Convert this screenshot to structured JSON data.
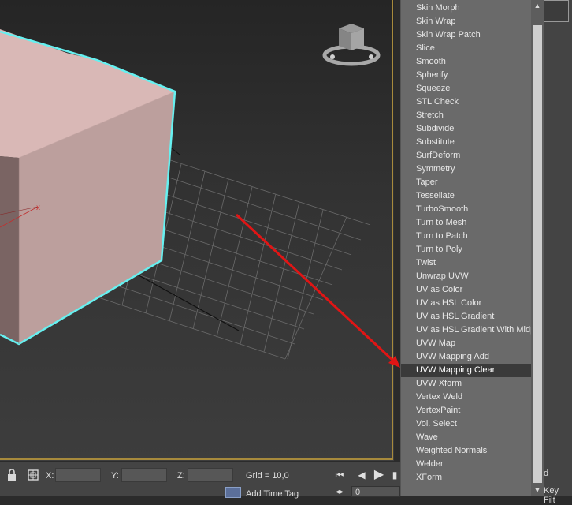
{
  "viewport": {
    "grid_label": "Grid = 10,0",
    "axis_marker": "x",
    "colors": {
      "cube": "#d9b8b6",
      "selection": "#66f0f0",
      "arrow": "#e01515"
    }
  },
  "modifier_list": {
    "items": [
      "Skin Morph",
      "Skin Wrap",
      "Skin Wrap Patch",
      "Slice",
      "Smooth",
      "Spherify",
      "Squeeze",
      "STL Check",
      "Stretch",
      "Subdivide",
      "Substitute",
      "SurfDeform",
      "Symmetry",
      "Taper",
      "Tessellate",
      "TurboSmooth",
      "Turn to Mesh",
      "Turn to Patch",
      "Turn to Poly",
      "Twist",
      "Unwrap UVW",
      "UV as Color",
      "UV as HSL Color",
      "UV as HSL Gradient",
      "UV as HSL Gradient With Midpoint",
      "UVW Map",
      "UVW Mapping Add",
      "UVW Mapping Clear",
      "UVW Xform",
      "Vertex Weld",
      "VertexPaint",
      "Vol. Select",
      "Wave",
      "Weighted Normals",
      "Welder",
      "XForm"
    ],
    "selected": "UVW Mapping Clear"
  },
  "status": {
    "x_label": "X:",
    "y_label": "Y:",
    "z_label": "Z:",
    "x_value": "",
    "y_value": "",
    "z_value": "",
    "grid": "Grid = 10,0",
    "add_time_tag": "Add Time Tag",
    "frame": "0"
  },
  "right_panel": {
    "d_text": "d",
    "key_filters": "Key Filt"
  },
  "icons": {
    "lock": "lock-icon",
    "absolute": "absolute-mode-icon",
    "goto_start": "goto-start-icon",
    "prev_frame": "prev-frame-icon",
    "play": "play-icon",
    "next_frame": "next-frame-icon",
    "time_tag": "time-tag-icon",
    "key": "key-icon",
    "viewcube": "viewcube-icon"
  }
}
